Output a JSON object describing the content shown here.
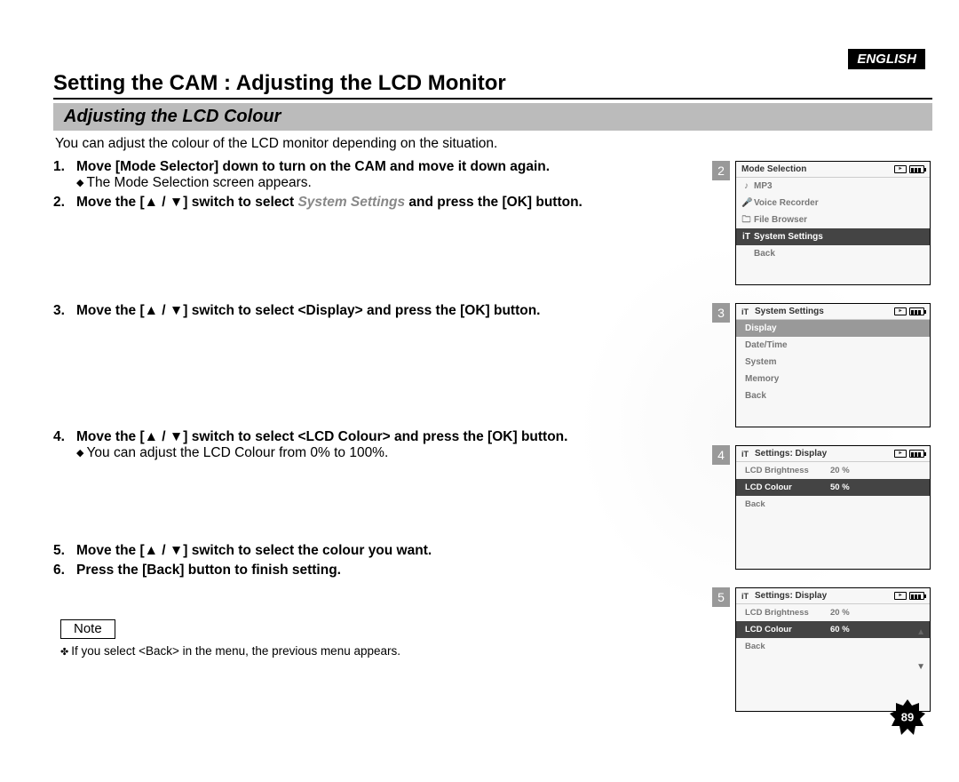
{
  "lang_badge": "ENGLISH",
  "title": "Setting the CAM : Adjusting the LCD Monitor",
  "section": "Adjusting the LCD Colour",
  "intro": "You can adjust the colour of the LCD monitor depending on the situation.",
  "steps": {
    "s1": {
      "num": "1.",
      "main": "Move [Mode Selector] down to turn on the CAM and move it down again.",
      "sub": "The Mode Selection screen appears."
    },
    "s2": {
      "num": "2.",
      "main_a": "Move the [",
      "main_b": "] switch to select ",
      "main_c": " and press the [OK] button.",
      "emph": "System Settings"
    },
    "s3": {
      "num": "3.",
      "main_a": "Move the [",
      "main_b": "] switch to select <Display> and press the [OK] button."
    },
    "s4": {
      "num": "4.",
      "main_a": "Move the [",
      "main_b": "] switch to select <LCD Colour> and press the [OK] button.",
      "sub": "You can adjust the LCD Colour from 0% to 100%."
    },
    "s5": {
      "num": "5.",
      "main_a": "Move the [",
      "main_b": "] switch to select the colour you want."
    },
    "s6": {
      "num": "6.",
      "main": "Press the [Back] button to finish setting."
    }
  },
  "note_label": "Note",
  "note_text": "If you select <Back> in the menu, the previous menu appears.",
  "screens": {
    "sc2": {
      "num": "2",
      "title": "Mode Selection",
      "items": [
        {
          "icon": "♪",
          "label": "MP3"
        },
        {
          "icon": "🎤",
          "label": "Voice Recorder"
        },
        {
          "icon": "🗀",
          "label": "File Browser"
        },
        {
          "icon": "iT",
          "label": "System Settings",
          "sel": true
        },
        {
          "icon": "",
          "label": "Back"
        }
      ]
    },
    "sc3": {
      "num": "3",
      "title": "System Settings",
      "title_icon": "iT",
      "items": [
        {
          "label": "Display",
          "sel": "light"
        },
        {
          "label": "Date/Time"
        },
        {
          "label": "System"
        },
        {
          "label": "Memory"
        },
        {
          "label": "Back"
        }
      ]
    },
    "sc4": {
      "num": "4",
      "title": "Settings: Display",
      "title_icon": "iT",
      "rows": [
        {
          "k": "LCD Brightness",
          "v": "20 %"
        },
        {
          "k": "LCD Colour",
          "v": "50 %",
          "sel": true
        },
        {
          "k": "Back",
          "v": ""
        }
      ]
    },
    "sc5": {
      "num": "5",
      "title": "Settings: Display",
      "title_icon": "iT",
      "rows": [
        {
          "k": "LCD Brightness",
          "v": "20 %"
        },
        {
          "k": "LCD Colour",
          "v": "60 %",
          "sel": true
        },
        {
          "k": "Back",
          "v": ""
        }
      ],
      "arrows": true
    }
  },
  "updown": "▲ / ▼",
  "page_number": "89"
}
